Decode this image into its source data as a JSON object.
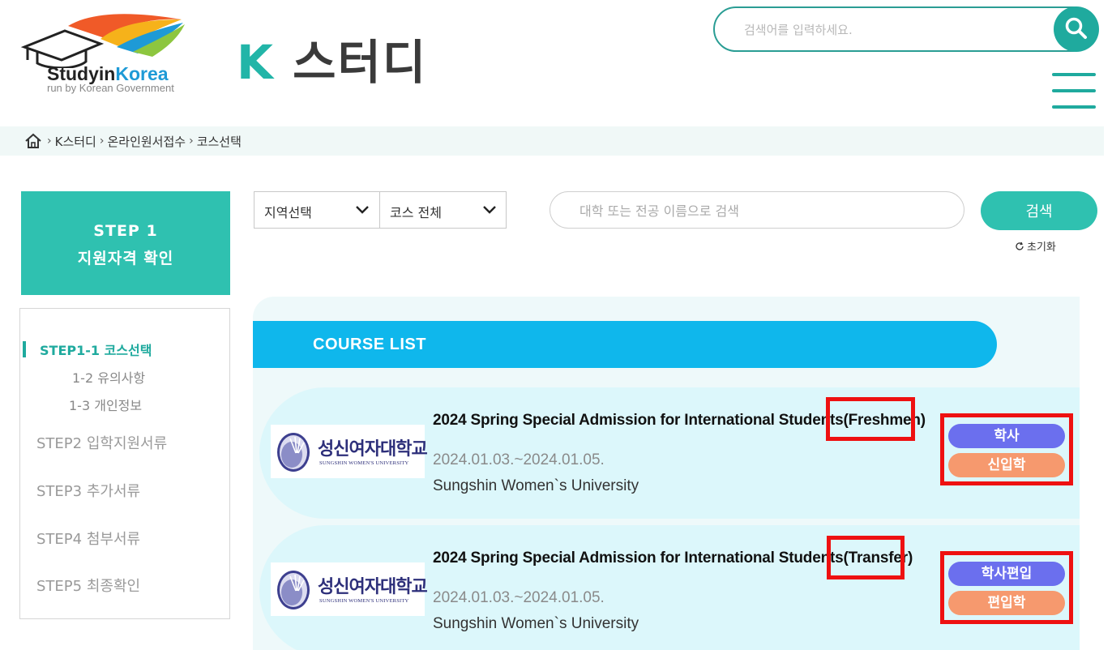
{
  "header": {
    "logo_name_part1": "Studyin",
    "logo_name_part2": "Korea",
    "logo_subtitle": "run by Korean Government",
    "site_title_k": "K",
    "site_title_rest": "스터디",
    "search_placeholder": "검색어를 입력하세요."
  },
  "breadcrumb": {
    "items": [
      "K스터디",
      "온라인원서접수",
      "코스선택"
    ]
  },
  "sidebar": {
    "step_line1": "STEP 1",
    "step_line2": "지원자격 확인",
    "active_item": "STEP1-1 코스선택",
    "sub_items": [
      "1-2 유의사항",
      "1-3 개인정보"
    ],
    "steps": [
      "STEP2 입학지원서류",
      "STEP3 추가서류",
      "STEP4 첨부서류",
      "STEP5 최종확인"
    ]
  },
  "filters": {
    "region_select": "지역선택",
    "course_select": "코스 전체",
    "search_placeholder": "대학 또는 전공 이름으로 검색",
    "search_button": "검색",
    "reset_label": "초기화"
  },
  "course_list": {
    "header": "COURSE LIST",
    "courses": [
      {
        "title": "2024 Spring Special Admission for International Students(Freshmen)",
        "date": "2024.01.03.~2024.01.05.",
        "university": "Sungshin Women`s University",
        "logo_korean": "성신여자대학교",
        "logo_english": "SUNGSHIN WOMEN'S UNIVERSITY",
        "tag1": "학사",
        "tag2": "신입학"
      },
      {
        "title": "2024 Spring Special Admission for International Students(Transfer)",
        "date": "2024.01.03.~2024.01.05.",
        "university": "Sungshin Women`s University",
        "logo_korean": "성신여자대학교",
        "logo_english": "SUNGSHIN WOMEN'S UNIVERSITY",
        "tag1": "학사편입",
        "tag2": "편입학"
      }
    ]
  },
  "colors": {
    "teal": "#2fc1b0",
    "list_header": "#0fb7ec",
    "highlight": "#ee1111",
    "tag_purple": "#6b6fee",
    "tag_orange": "#f6996e"
  }
}
